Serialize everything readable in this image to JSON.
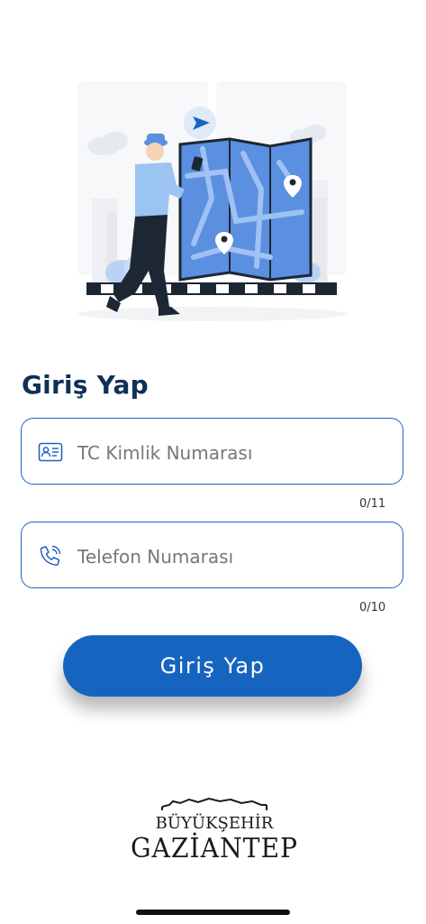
{
  "login": {
    "title": "Giriş Yap",
    "tc_field": {
      "placeholder": "TC Kimlik Numarası",
      "value": "",
      "counter": "0/11",
      "icon": "id-card-icon"
    },
    "phone_field": {
      "placeholder": "Telefon Numarası",
      "value": "",
      "counter": "0/10",
      "icon": "phone-call-icon"
    },
    "submit_label": "Giriş Yap"
  },
  "footer": {
    "logo_line1": "BÜYÜKŞEHİR",
    "logo_line2": "GAZİANTEP"
  },
  "colors": {
    "primary": "#1565c0",
    "title": "#0f3057",
    "border": "#1f63c2",
    "map_blue": "#5b8fe0"
  }
}
